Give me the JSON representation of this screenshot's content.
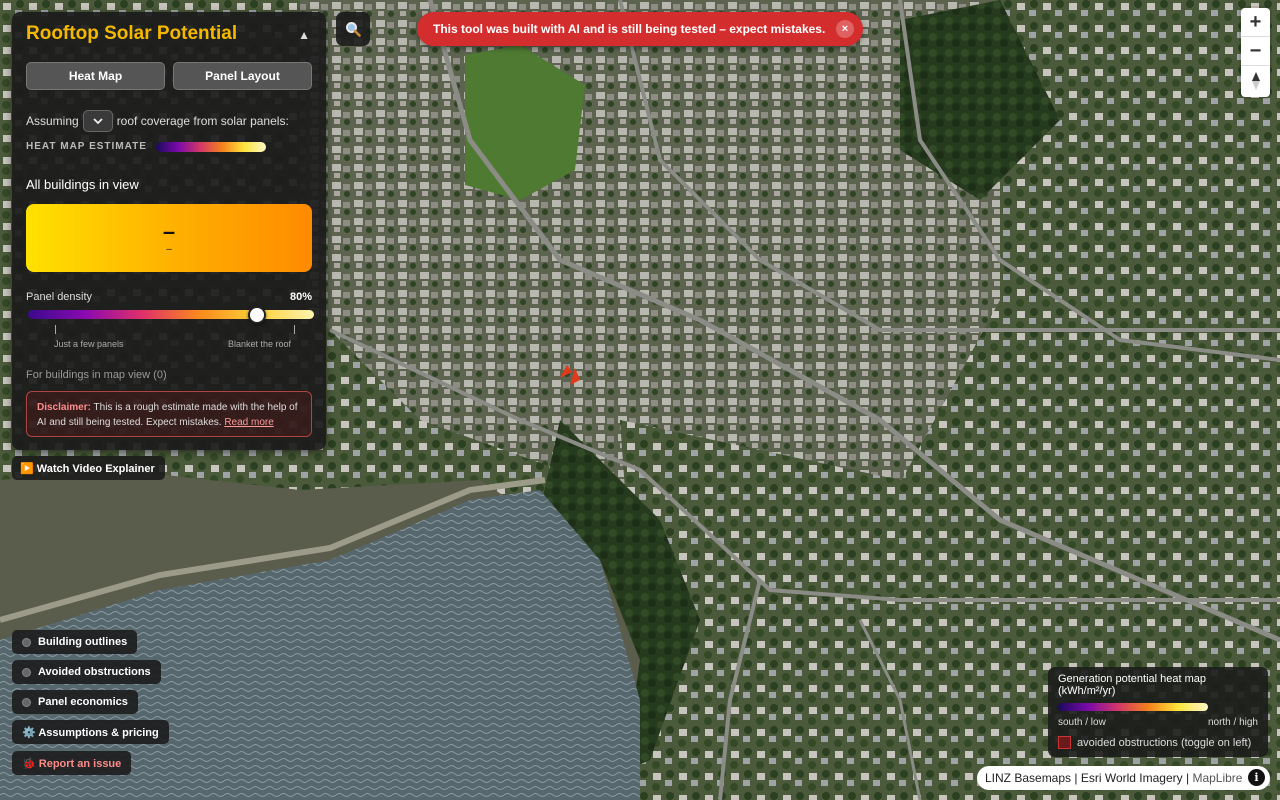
{
  "panel": {
    "title": "Rooftop Solar Potential",
    "collapse_icon": "▲",
    "tabs": [
      {
        "label": "Heat Map"
      },
      {
        "label": "Panel Layout"
      }
    ],
    "assuming_prefix": "Assuming",
    "assuming_suffix": "roof coverage from solar panels:",
    "heat_label": "HEAT MAP ESTIMATE",
    "all_buildings": "All buildings in view",
    "summary_main": "–",
    "summary_sub": "–",
    "density": {
      "label": "Panel density",
      "value_text": "80%",
      "value": 0.8,
      "low_label": "Just a few panels",
      "high_label": "Blanket the roof"
    },
    "for_buildings": "For buildings in map view (0)",
    "disclaimer": {
      "bold": "Disclaimer:",
      "text": " This is a rough estimate made with the help of AI and still being tested. Expect mistakes. ",
      "link": "Read more"
    }
  },
  "banner": {
    "text": "This tool was built with AI and is still being tested – expect mistakes.",
    "close": "×"
  },
  "zoom": {
    "in": "+",
    "out": "−"
  },
  "video_button": "▶️ Watch Video Explainer",
  "layers": [
    {
      "label": "Building outlines"
    },
    {
      "label": "Avoided obstructions"
    },
    {
      "label": "Panel economics"
    }
  ],
  "assumptions_button": "⚙️ Assumptions & pricing",
  "report_button": "🐞 Report an issue",
  "legend": {
    "title": "Generation potential heat map (kWh/m²/yr)",
    "low": "south / low",
    "high": "north / high",
    "obstructions": "avoided obstructions (toggle on left)"
  },
  "attribution": {
    "linz": "LINZ Basemaps",
    "esri": "Esri World Imagery",
    "maplibre": "MapLibre",
    "separator": " | ",
    "info": "i"
  },
  "colors": {
    "accent": "#f5b800",
    "banner": "#d42d2d",
    "summary_start": "#ffe100",
    "summary_end": "#ff8a00"
  }
}
